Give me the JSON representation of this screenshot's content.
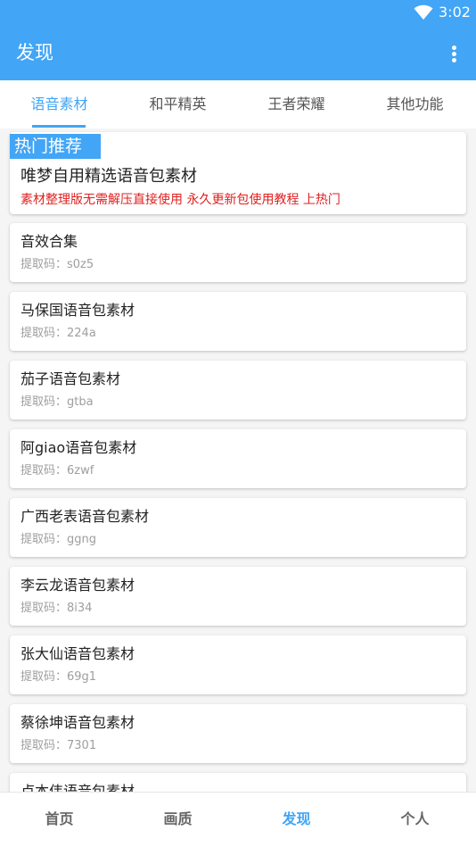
{
  "status_bar": {
    "time": "3:02",
    "wifi_icon": "wifi-icon"
  },
  "app_bar": {
    "title": "发现",
    "menu_icon": "more-vert-icon"
  },
  "tabs": [
    {
      "label": "语音素材",
      "active": true
    },
    {
      "label": "和平精英",
      "active": false
    },
    {
      "label": "王者荣耀",
      "active": false
    },
    {
      "label": "其他功能",
      "active": false
    }
  ],
  "hot": {
    "tag": "热门推荐",
    "title": "唯梦自用精选语音包素材",
    "desc": "素材整理版无需解压直接使用 永久更新包使用教程 上热门"
  },
  "items": [
    {
      "title": "音效合集",
      "code": "提取码：s0z5"
    },
    {
      "title": "马保国语音包素材",
      "code": "提取码：224a"
    },
    {
      "title": "茄子语音包素材",
      "code": "提取码：gtba"
    },
    {
      "title": "阿giao语音包素材",
      "code": "提取码：6zwf"
    },
    {
      "title": "广西老表语音包素材",
      "code": "提取码：ggng"
    },
    {
      "title": "李云龙语音包素材",
      "code": "提取码：8i34"
    },
    {
      "title": "张大仙语音包素材",
      "code": "提取码：69g1"
    },
    {
      "title": "蔡徐坤语音包素材",
      "code": "提取码：7301"
    },
    {
      "title": "卢本伟语音包素材",
      "code": ""
    }
  ],
  "bottom_nav": [
    {
      "label": "首页",
      "active": false
    },
    {
      "label": "画质",
      "active": false
    },
    {
      "label": "发现",
      "active": true
    },
    {
      "label": "个人",
      "active": false
    }
  ],
  "colors": {
    "primary": "#42a5f5",
    "hot_desc": "#e02020",
    "code_text": "#9e9e9e"
  }
}
